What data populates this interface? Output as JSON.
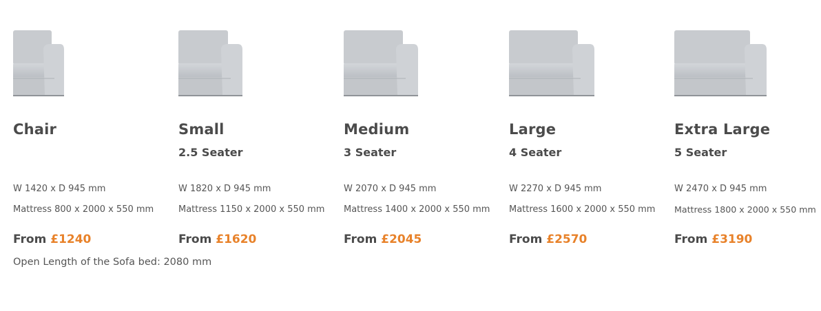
{
  "products": [
    {
      "title": "Chair",
      "subtitle": "",
      "dims": "W 1420 x D 945 mm",
      "mattress": "Mattress 800 x 2000 x 550 mm",
      "price_prefix": "From",
      "price": "£1240"
    },
    {
      "title": "Small",
      "subtitle": "2.5 Seater",
      "dims": "W 1820 x D 945 mm",
      "mattress": "Mattress 1150 x 2000 x 550 mm",
      "price_prefix": "From",
      "price": "£1620"
    },
    {
      "title": "Medium",
      "subtitle": "3 Seater",
      "dims": "W 2070 x D 945 mm",
      "mattress": "Mattress 1400 x 2000 x 550 mm",
      "price_prefix": "From",
      "price": "£2045"
    },
    {
      "title": "Large",
      "subtitle": "4 Seater",
      "dims": "W 2270 x D 945 mm",
      "mattress": "Mattress 1600 x 2000 x 550 mm",
      "price_prefix": "From",
      "price": "£2570"
    },
    {
      "title": "Extra Large",
      "subtitle": "5 Seater",
      "dims": "W 2470 x D 945 mm",
      "mattress": "Mattress 1800 x 2000 x 550 mm",
      "price_prefix": "From",
      "price": "£3190"
    }
  ],
  "note": "Open Length of the Sofa bed: 2080 mm",
  "colors": {
    "price_accent": "#e8822a",
    "text": "#4b4b4b",
    "sofa_fabric": "#c9ccd0"
  }
}
